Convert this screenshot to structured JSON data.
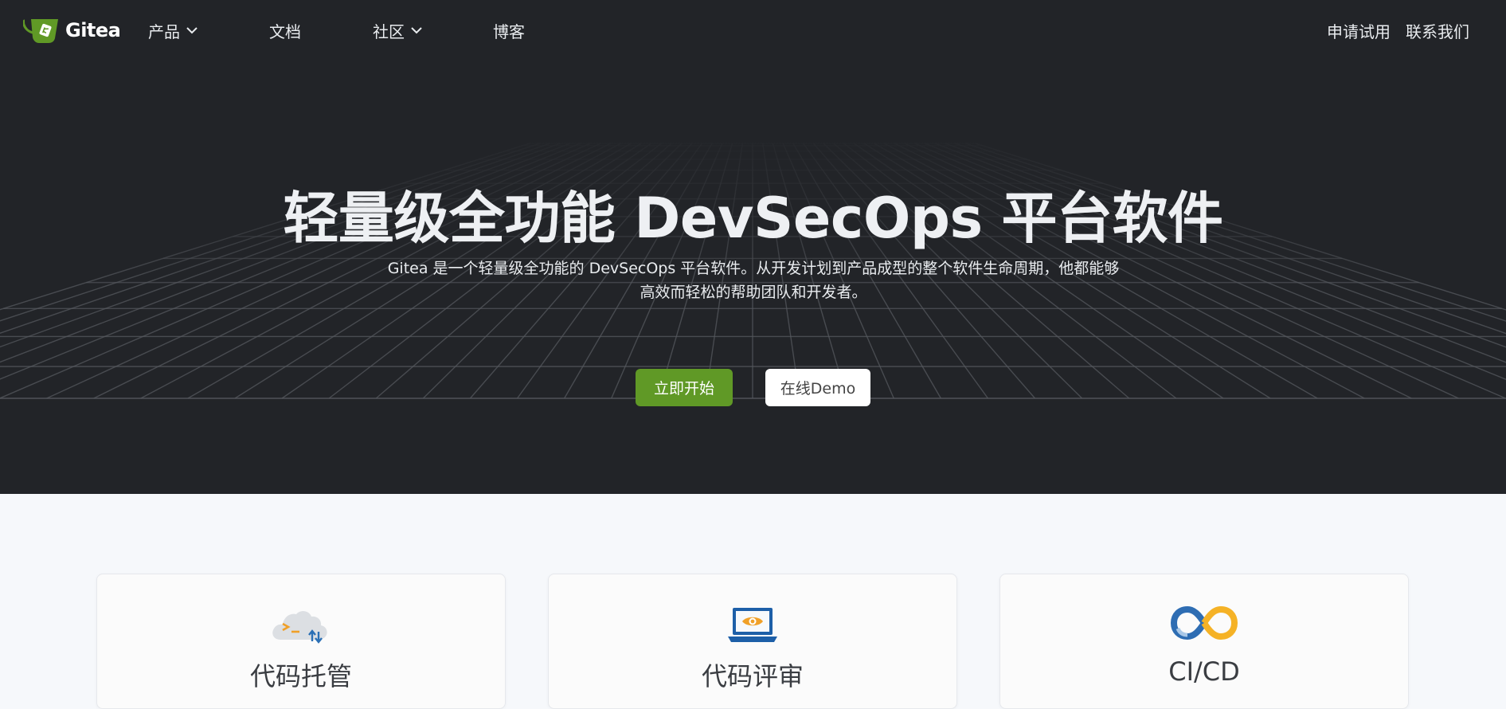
{
  "brand": {
    "name": "Gitea"
  },
  "nav": {
    "items": [
      {
        "label": "产品",
        "has_dropdown": true
      },
      {
        "label": "文档",
        "has_dropdown": false
      },
      {
        "label": "社区",
        "has_dropdown": true
      },
      {
        "label": "博客",
        "has_dropdown": false
      }
    ],
    "right": [
      {
        "label": "申请试用"
      },
      {
        "label": "联系我们"
      }
    ]
  },
  "hero": {
    "title": "轻量级全功能 DevSecOps 平台软件",
    "subtitle": "Gitea 是一个轻量级全功能的 DevSecOps 平台软件。从开发计划到产品成型的整个软件生命周期，他都能够高效而轻松的帮助团队和开发者。",
    "primary_button": "立即开始",
    "secondary_button": "在线Demo"
  },
  "features": [
    {
      "title": "代码托管",
      "icon": "cloud-terminal-icon"
    },
    {
      "title": "代码评审",
      "icon": "laptop-eye-icon"
    },
    {
      "title": "CI/CD",
      "icon": "infinity-loop-icon"
    }
  ],
  "colors": {
    "hero_bg": "#222428",
    "accent_green": "#609926",
    "grid_line": "#55585e",
    "page_bg": "#f6f8fb"
  }
}
